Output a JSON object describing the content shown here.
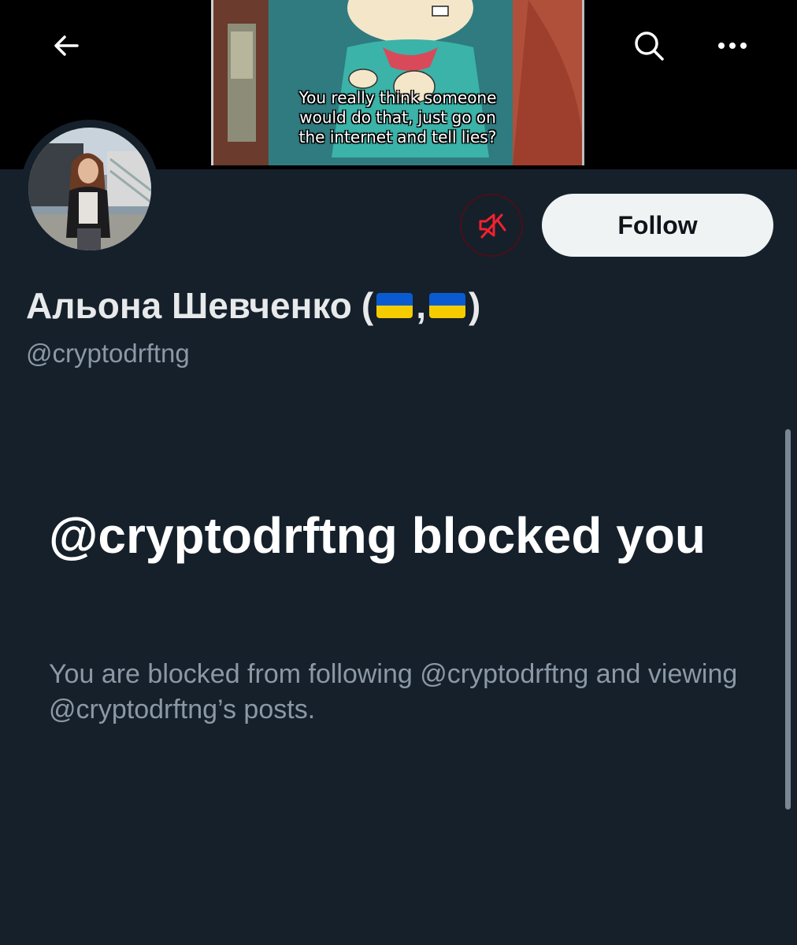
{
  "banner": {
    "meme_caption": "You really think someone would do that, just go on the internet and tell lies?",
    "meme_lines": [
      "You really think someone",
      "would do that, just go on",
      "the internet and tell lies?"
    ]
  },
  "header": {
    "back_icon": "arrow-left-icon",
    "search_icon": "search-icon",
    "more_icon": "more-horizontal-icon"
  },
  "profile": {
    "name_text": "Альона Шевченко",
    "name_open": "(",
    "name_sep": ",",
    "name_close": ")",
    "flag_icons": [
      "ukraine-flag-icon",
      "ukraine-flag-icon"
    ],
    "handle": "@cryptodrftng",
    "mute_icon": "muted-speaker-icon",
    "follow_label": "Follow"
  },
  "blocked": {
    "title": "@cryptodrftng blocked you",
    "description": "You are blocked from following @cryptodrftng and viewing @cryptodrftng’s posts."
  },
  "colors": {
    "background": "#15202b",
    "muted_text": "#8b98a5",
    "mute_red": "#f4212e",
    "follow_bg": "#eff3f4"
  }
}
